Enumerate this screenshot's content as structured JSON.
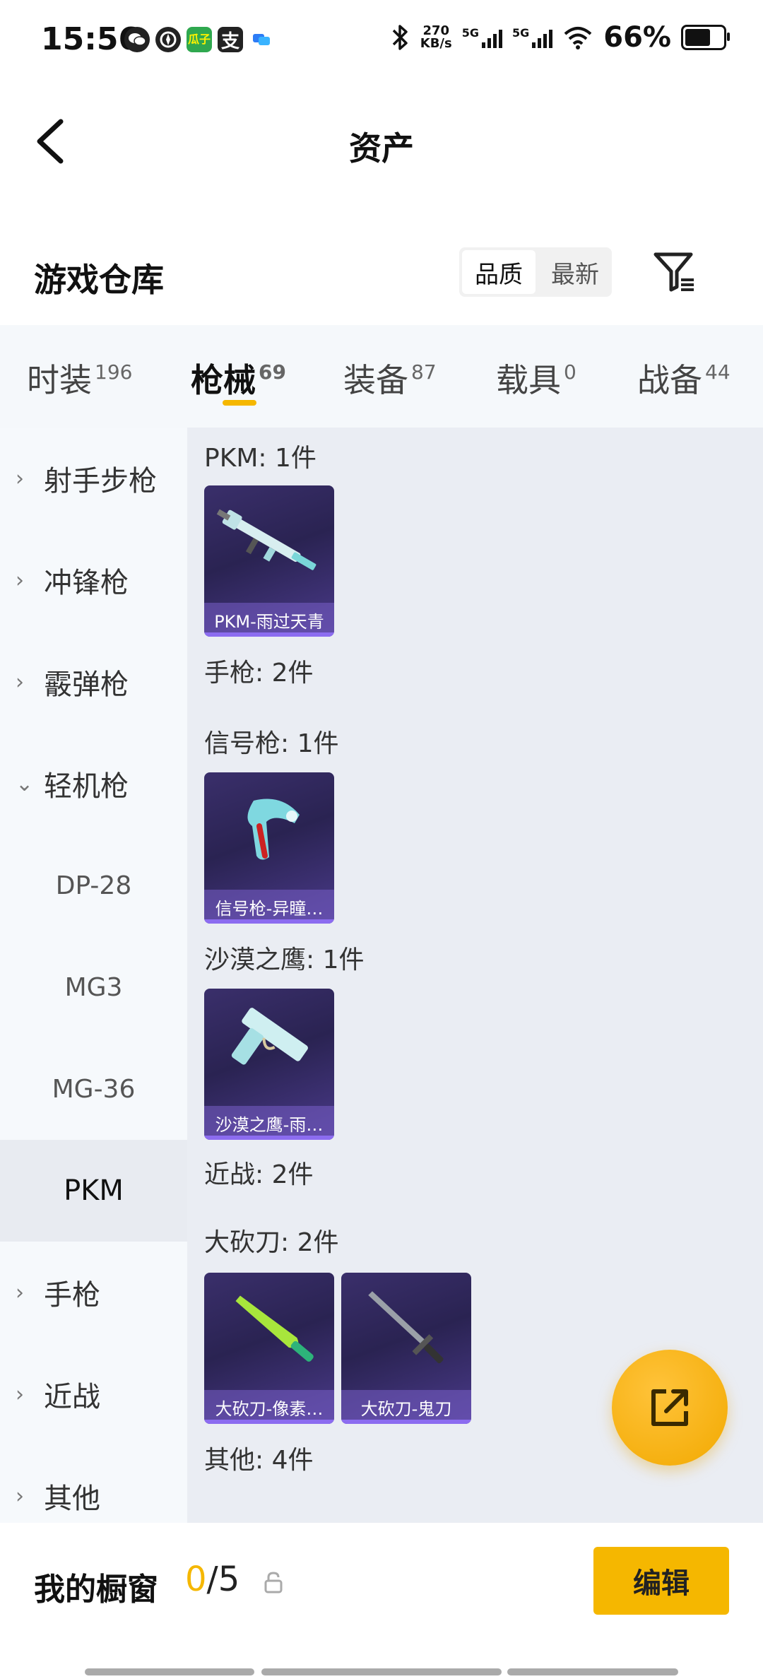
{
  "status_bar": {
    "time": "15:56",
    "left_icons": [
      "wechat-icon",
      "compass-icon",
      "melon-app-icon",
      "pay-app-icon",
      "chat-app-icon"
    ],
    "melon_icon_label": "瓜子",
    "pay_icon_label": "支",
    "net_speed_value": "270",
    "net_speed_unit": "KB/s",
    "signal_1_label": "5G",
    "signal_2_label": "5G",
    "battery": "66%"
  },
  "header": {
    "title": "资产"
  },
  "warehouse": {
    "title": "游戏仓库",
    "sort_options": [
      "品质",
      "最新"
    ],
    "selected_sort": "品质"
  },
  "tabs": [
    {
      "label": "时装",
      "count": "196"
    },
    {
      "label": "枪械",
      "count": "69"
    },
    {
      "label": "装备",
      "count": "87"
    },
    {
      "label": "载具",
      "count": "0"
    },
    {
      "label": "战备",
      "count": "44"
    }
  ],
  "active_tab": "枪械",
  "sidebar": {
    "items": [
      {
        "label": "射手步枪",
        "chevron": "›"
      },
      {
        "label": "冲锋枪",
        "chevron": "›"
      },
      {
        "label": "霰弹枪",
        "chevron": "›"
      },
      {
        "label": "轻机枪",
        "chevron": "⌄"
      },
      {
        "label": "DP-28"
      },
      {
        "label": "MG3"
      },
      {
        "label": "MG-36"
      },
      {
        "label": "PKM"
      },
      {
        "label": "手枪",
        "chevron": "›"
      },
      {
        "label": "近战",
        "chevron": "›"
      },
      {
        "label": "其他",
        "chevron": "›"
      }
    ],
    "selected": "PKM"
  },
  "content": {
    "pkm_label": "PKM: 1件",
    "pkm_item": "PKM-雨过天青",
    "pistol_label": "手枪: 2件",
    "flare_label": "信号枪: 1件",
    "flare_item": "信号枪-异瞳…",
    "deagle_label": "沙漠之鹰: 1件",
    "deagle_item": "沙漠之鹰-雨…",
    "melee_label": "近战: 2件",
    "machete_label": "大砍刀: 2件",
    "machete_item_1": "大砍刀-像素…",
    "machete_item_2": "大砍刀-鬼刀",
    "other_label": "其他: 4件"
  },
  "bottom_bar": {
    "title": "我的橱窗",
    "count_current": "0",
    "count_total": "/5",
    "edit_label": "编辑"
  },
  "colors": {
    "accent": "#f5b700",
    "card_bg": "#2a2352",
    "rarity": "#8c6cf0"
  }
}
